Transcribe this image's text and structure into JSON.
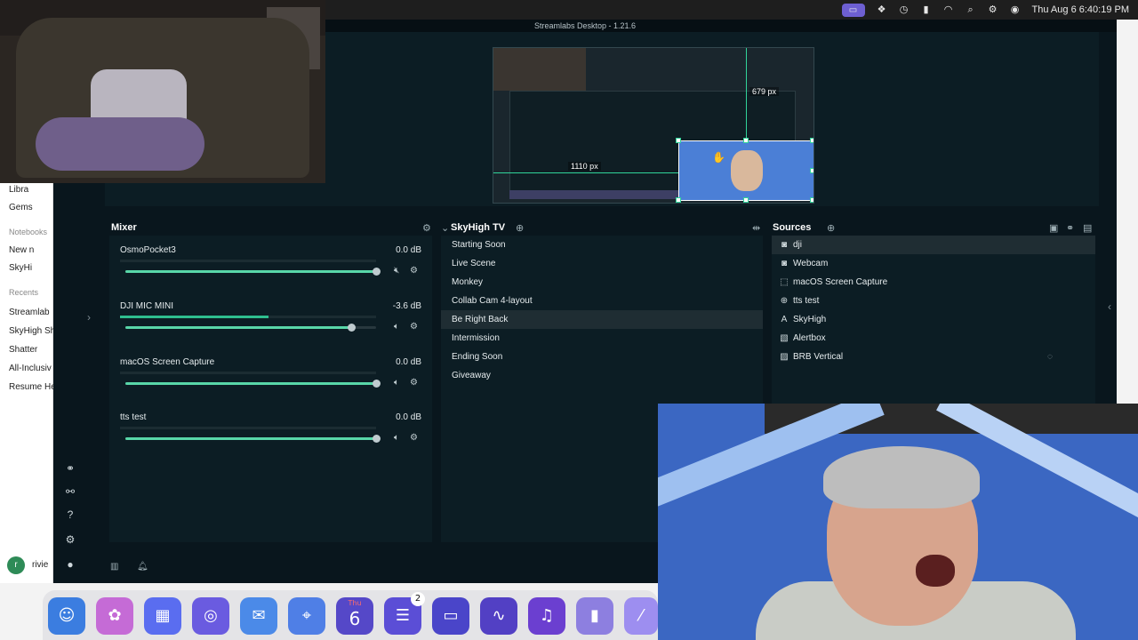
{
  "menubar": {
    "clock": "Thu Aug 6  6:40:19 PM"
  },
  "window": {
    "title": "Streamlabs Desktop - 1.21.6"
  },
  "preview": {
    "height_guide": "679 px",
    "width_guide": "1110 px"
  },
  "background_app": {
    "items_top": [
      "Libra",
      "Gems"
    ],
    "notebooks_header": "Notebooks",
    "notebook_items": [
      "New n",
      "SkyHi"
    ],
    "recents_header": "Recents",
    "recent_items": [
      "Streamlab",
      "SkyHigh Sh",
      "Shatter",
      "All-Inclusiv",
      "Resume He"
    ],
    "avatar_letter": "r",
    "user_name": "rivie"
  },
  "mixer": {
    "title": "Mixer",
    "items": [
      {
        "name": "OsmoPocket3",
        "db": "0.0 dB",
        "meter": 0,
        "volume": 1.0
      },
      {
        "name": "DJI MIC MINI",
        "db": "-3.6 dB",
        "meter": 0.58,
        "volume": 0.9
      },
      {
        "name": "macOS Screen Capture",
        "db": "0.0 dB",
        "meter": 0,
        "volume": 1.0
      },
      {
        "name": "tts test",
        "db": "0.0 dB",
        "meter": 0,
        "volume": 1.0
      }
    ]
  },
  "scenes": {
    "title": "SkyHigh TV",
    "items": [
      "Starting Soon",
      "Live Scene",
      "Monkey",
      "Collab Cam 4-layout",
      "Be Right Back",
      "Intermission",
      "Ending Soon",
      "Giveaway"
    ],
    "active_index": 4
  },
  "sources": {
    "title": "Sources",
    "items": [
      {
        "label": "dji",
        "icon": "webcam-icon"
      },
      {
        "label": "Webcam",
        "icon": "webcam-icon"
      },
      {
        "label": "macOS Screen Capture",
        "icon": "screen-capture-icon"
      },
      {
        "label": "tts test",
        "icon": "globe-icon"
      },
      {
        "label": "SkyHigh",
        "icon": "text-icon"
      },
      {
        "label": "Alertbox",
        "icon": "alertbox-icon"
      },
      {
        "label": "BRB Vertical",
        "icon": "image-icon"
      }
    ],
    "active_index": 0
  },
  "dock": {
    "calendar_day": "Thu",
    "calendar_date": "6",
    "reminders_badge": "2"
  },
  "colors": {
    "accent": "#31d49a",
    "panel_bg": "#0c1d24",
    "window_bg": "#09161d"
  }
}
